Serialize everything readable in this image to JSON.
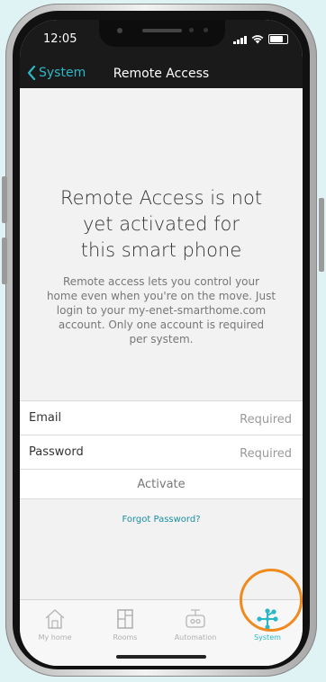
{
  "status_bar": {
    "time": "12:05"
  },
  "nav": {
    "back_label": "System",
    "title": "Remote Access"
  },
  "message": {
    "heading_lines": [
      "Remote Access is not",
      "yet activated for",
      "this smart phone"
    ],
    "description_lines": [
      "Remote access lets you control your",
      "home even when you're on the move. Just",
      "login to your my-enet-smarthome.com",
      "account. Only one account is required",
      "per system."
    ]
  },
  "form": {
    "email_label": "Email",
    "email_placeholder": "Required",
    "email_value": "",
    "password_label": "Password",
    "password_placeholder": "Required",
    "password_value": "",
    "activate_label": "Activate",
    "forgot_label": "Forgot Password?"
  },
  "tabs": [
    {
      "label": "My home",
      "icon": "house-icon",
      "active": false
    },
    {
      "label": "Rooms",
      "icon": "rooms-icon",
      "active": false
    },
    {
      "label": "Automation",
      "icon": "automation-icon",
      "active": false
    },
    {
      "label": "System",
      "icon": "system-icon",
      "active": true
    }
  ],
  "colors": {
    "accent": "#2ab7c6",
    "highlight_ring": "#f08a1d",
    "nav_background": "#1a1a1a",
    "screen_background": "#f2f2f2"
  }
}
